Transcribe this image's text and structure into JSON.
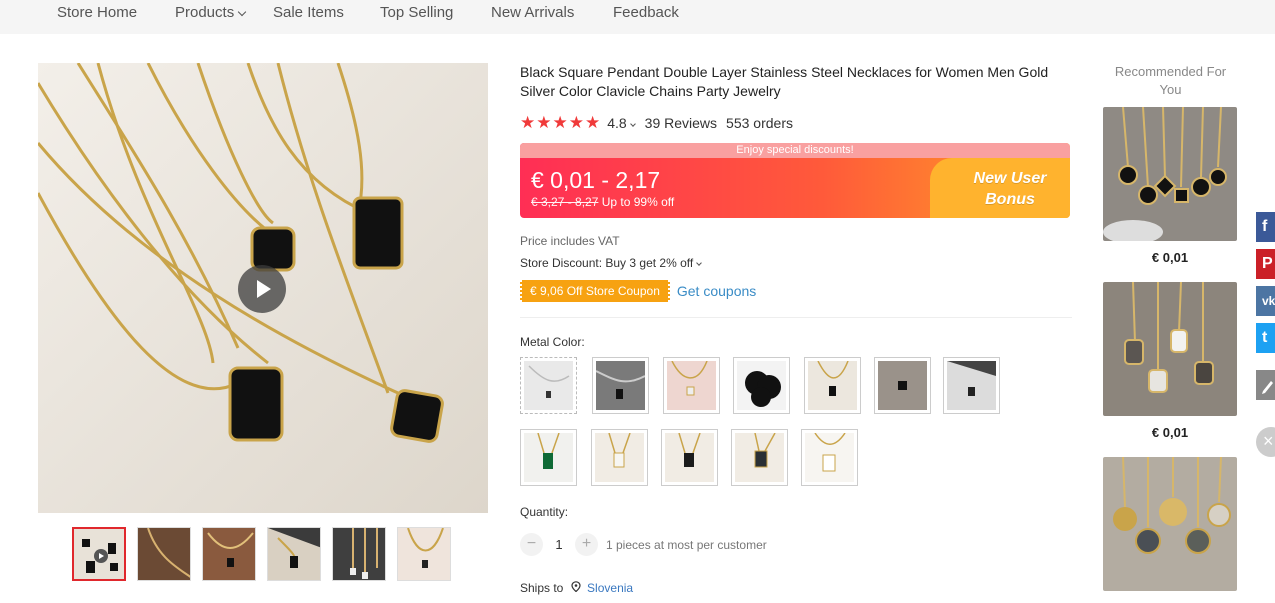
{
  "nav": {
    "items": [
      "Store Home",
      "Products",
      "Sale Items",
      "Top Selling",
      "New Arrivals",
      "Feedback"
    ]
  },
  "product": {
    "title": "Black Square Pendant Double Layer Stainless Steel Necklaces for Women Men Gold Silver Color Clavicle Chains Party Jewelry",
    "stars": "★★★★★",
    "rating": "4.8",
    "reviews": "39 Reviews",
    "orders": "553 orders"
  },
  "price": {
    "banner_note": "Enjoy special discounts!",
    "range": "€ 0,01 - 2,17",
    "original": "€ 3,27 - 8,27",
    "discount": "Up to 99% off",
    "bonus_line1": "New User",
    "bonus_line2": "Bonus"
  },
  "vat": "Price includes VAT",
  "store_discount": "Store Discount: Buy 3 get 2% off",
  "coupon": {
    "label": "€ 9,06 Off Store Coupon",
    "link": "Get coupons"
  },
  "metal_color": {
    "label": "Metal Color:"
  },
  "quantity": {
    "label": "Quantity:",
    "minus": "−",
    "plus": "+",
    "value": "1",
    "note": "1 pieces at most per customer"
  },
  "shipping": {
    "label": "Ships to",
    "country": "Slovenia"
  },
  "recommended": {
    "title": "Recommended For You",
    "items": [
      {
        "price": "€ 0,01"
      },
      {
        "price": "€ 0,01"
      }
    ]
  },
  "share": {
    "facebook": "f",
    "pinterest": "P",
    "vk": "vk",
    "twitter": "t",
    "close": "×"
  }
}
